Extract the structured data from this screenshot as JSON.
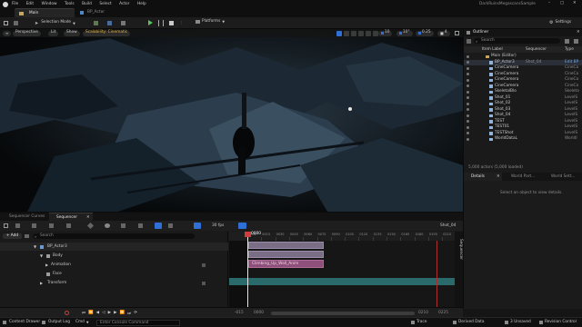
{
  "menu": {
    "items": [
      "File",
      "Edit",
      "Window",
      "Tools",
      "Build",
      "Select",
      "Actor",
      "Help"
    ],
    "project": "DarkRuinsMegascansSample"
  },
  "tabs": {
    "level": "Main",
    "secondary": "BP_Actor"
  },
  "toolbar": {
    "mode": "Selection Mode",
    "platforms": "Platforms",
    "settings": "Settings"
  },
  "viewport": {
    "perspective": "Perspective",
    "lit": "Lit",
    "show": "Show",
    "scalability": "Scalability: Cinematic",
    "fov": "10",
    "grid": "10°",
    "scale": "0.25",
    "camspeed": "4"
  },
  "outliner": {
    "title": "Outliner",
    "search_placeholder": "Search",
    "col_label": "Item Label",
    "col_seq": "Sequencer",
    "col_type": "Type",
    "items": [
      {
        "label": "Main (Editor)",
        "type": ""
      },
      {
        "label": "BP_Actor3",
        "extra": "Shot_04",
        "type": "Edit BP"
      },
      {
        "label": "CineCamera",
        "type": "CineCa"
      },
      {
        "label": "CineCamera",
        "type": "CineCa"
      },
      {
        "label": "CineCamera",
        "type": "CineCa"
      },
      {
        "label": "CineCamera",
        "type": "CineCa"
      },
      {
        "label": "SkeletalBlo",
        "type": "Skeleta"
      },
      {
        "label": "Shot_01",
        "type": "LevelS"
      },
      {
        "label": "Shot_02",
        "type": "LevelS"
      },
      {
        "label": "Shot_03",
        "type": "LevelS"
      },
      {
        "label": "Shot_04",
        "type": "LevelS"
      },
      {
        "label": "TEST",
        "type": "LevelS"
      },
      {
        "label": "TEST01",
        "type": "LevelS"
      },
      {
        "label": "TESTShot",
        "type": "LevelS"
      },
      {
        "label": "WorldDataL",
        "type": "WorldI"
      }
    ],
    "count": "5,000 actors (5,000 loaded)"
  },
  "details": {
    "tab1": "Details",
    "tab2": "World Part...",
    "tab3": "World Sett...",
    "empty": "Select an object to view details."
  },
  "sequencer": {
    "tab1": "Sequencer Curves",
    "tab2": "Sequencer",
    "add": "+ Add",
    "search_placeholder": "Search",
    "fps": "30 fps",
    "shot": "Shot_04",
    "current_frame": "0000",
    "tracks": [
      "BP_Actor3",
      "Body",
      "Animation",
      "Face",
      "Transform"
    ],
    "anim_clip": "Climbing_Up_Wall_Anim",
    "ruler": [
      "0000",
      "0015",
      "0030",
      "0045",
      "0060",
      "0075",
      "0090",
      "0105",
      "0120",
      "0135",
      "0150",
      "0165",
      "0180",
      "0195",
      "0210"
    ],
    "start_label": "-015",
    "start2": "0000",
    "end_label": "0210",
    "end2": "0225",
    "side_label": "Sequencer"
  },
  "status": {
    "content_drawer": "Content Drawer",
    "output_log": "Output Log",
    "cmd": "Cmd",
    "cmd_placeholder": "Enter Console Command",
    "trace": "Trace",
    "derived": "Derived Data",
    "unsaved": "3 Unsaved",
    "revision": "Revision Control"
  }
}
